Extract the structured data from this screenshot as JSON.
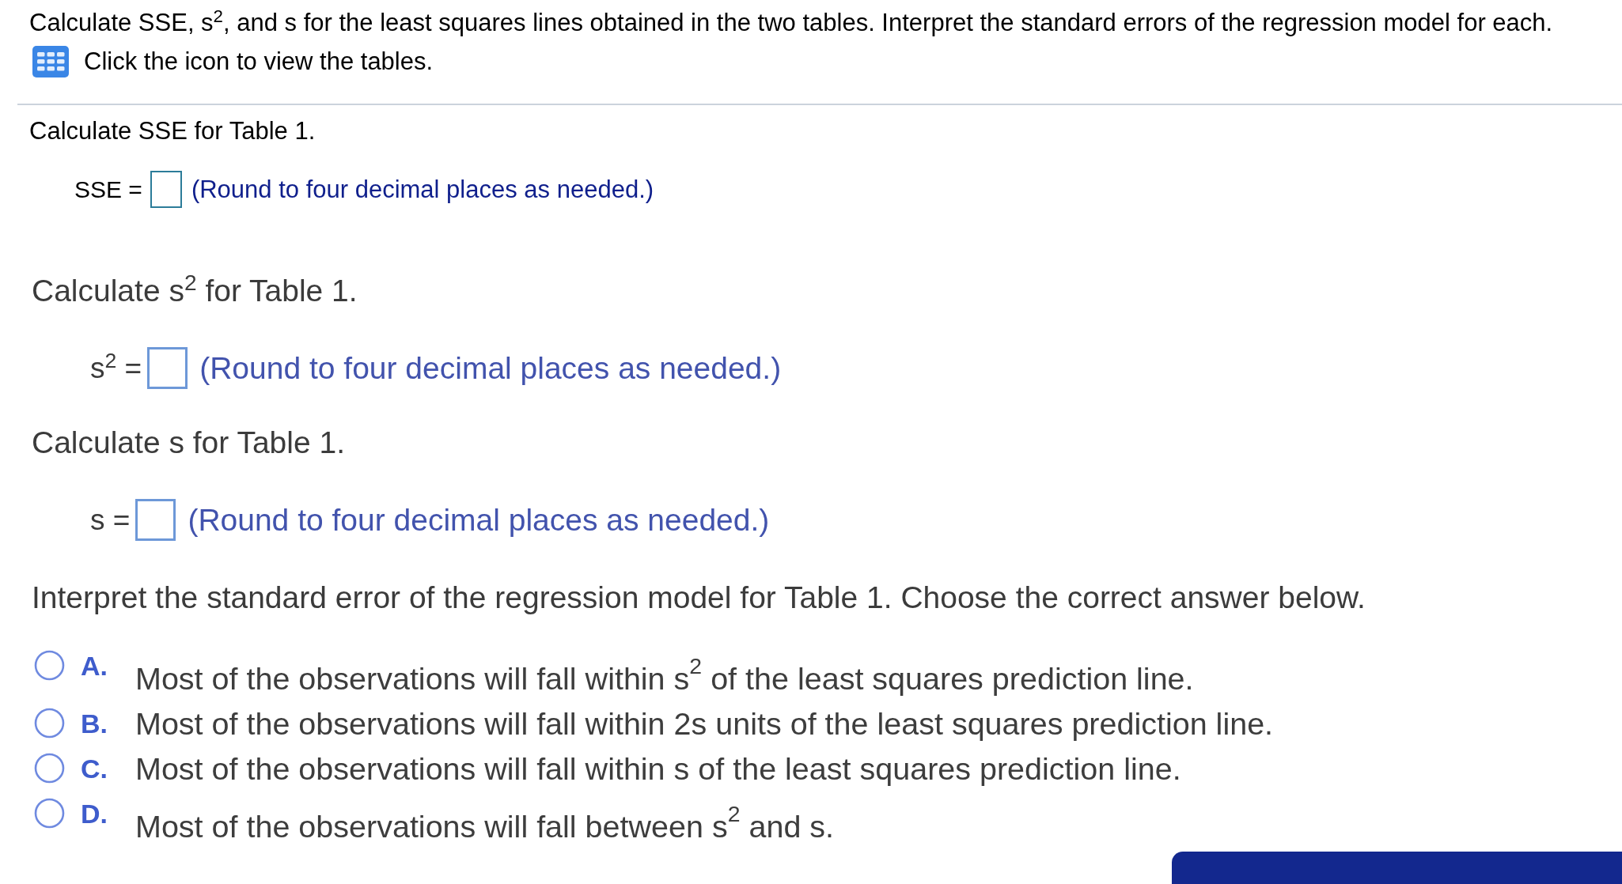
{
  "question": {
    "text": "Calculate SSE, s$^{2}$, and s for the least squares lines obtained in the two tables. Interpret the standard errors of the regression model for each.",
    "tables_link": "Click the icon to view the tables."
  },
  "parts": [
    {
      "kind": "compact",
      "prompt": "Calculate SSE for Table 1.",
      "answer": {
        "label": "SSE =",
        "hint": "(Round to four decimal places as needed.)"
      }
    },
    {
      "kind": "large",
      "prompt": "Calculate s$^{2}$ for Table 1.",
      "answer": {
        "label": "s$^{2}$ =",
        "hint": "(Round to four decimal places as needed.)"
      }
    },
    {
      "kind": "large",
      "prompt": "Calculate s for Table 1.",
      "answer": {
        "label": "s =",
        "hint": "(Round to four decimal places as needed.)"
      }
    }
  ],
  "multiple_choice": {
    "prompt": "Interpret the standard error of the regression model for Table 1. Choose the correct answer below.",
    "options": [
      {
        "letter": "A.",
        "text": "Most of the observations will fall within s$^{2}$ of the least squares prediction line.",
        "selected": false
      },
      {
        "letter": "B.",
        "text": "Most of the observations will fall within 2s units of the least squares prediction line.",
        "selected": false
      },
      {
        "letter": "C.",
        "text": "Most of the observations will fall within s of the least squares prediction line.",
        "selected": false
      },
      {
        "letter": "D.",
        "text": "Most of the observations will fall between s$^{2}$ and s.",
        "selected": false
      }
    ]
  }
}
